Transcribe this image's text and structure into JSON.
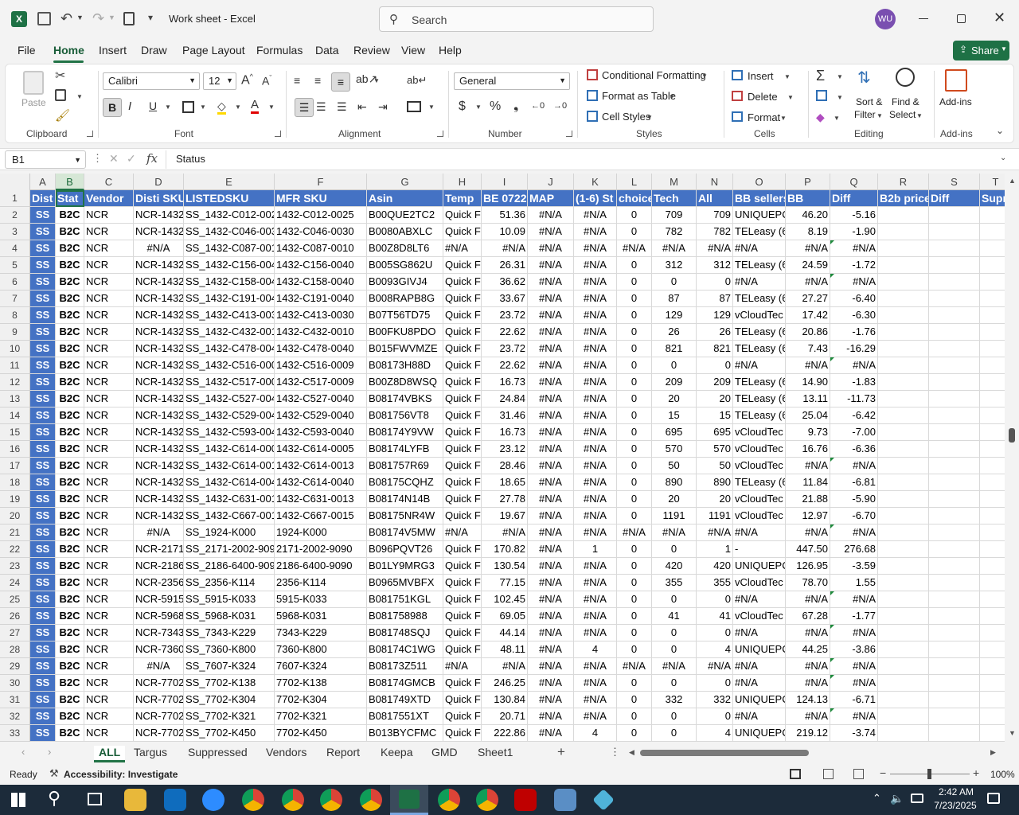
{
  "title": {
    "quick_access_dropdown": "▾",
    "doc": "Work sheet  -  Excel",
    "search_placeholder": "Search",
    "avatar": "WU"
  },
  "menu": [
    "File",
    "Home",
    "Insert",
    "Draw",
    "Page Layout",
    "Formulas",
    "Data",
    "Review",
    "View",
    "Help"
  ],
  "share_label": "Share",
  "ribbon": {
    "paste": "Paste",
    "font_name": "Calibri",
    "font_size": "12",
    "number_format": "General",
    "cond_format": "Conditional Formatting",
    "format_table": "Format as Table",
    "cell_styles": "Cell Styles",
    "insert": "Insert",
    "delete": "Delete",
    "format": "Format",
    "sort_filter_1": "Sort &",
    "sort_filter_2": "Filter",
    "find_select_1": "Find &",
    "find_select_2": "Select",
    "addins": "Add-ins",
    "groups": {
      "clipboard": "Clipboard",
      "font": "Font",
      "alignment": "Alignment",
      "number": "Number",
      "styles": "Styles",
      "cells": "Cells",
      "editing": "Editing",
      "addins": "Add-ins"
    }
  },
  "formula": {
    "name_box": "B1",
    "fx": "fx",
    "content": "Status"
  },
  "columns": [
    "A",
    "B",
    "C",
    "D",
    "E",
    "F",
    "G",
    "H",
    "I",
    "J",
    "K",
    "L",
    "M",
    "N",
    "O",
    "P",
    "Q",
    "R",
    "S",
    "T"
  ],
  "header_row": [
    "Dist",
    "Stat",
    "Vendor",
    "Disti SKU",
    "LISTEDSKU",
    "MFR SKU",
    "Asin",
    "Temp",
    "BE 0722",
    "MAP",
    "(1-6) St",
    "choice",
    "Tech",
    "All",
    "BB sellers",
    "BB",
    "Diff",
    "B2b price",
    "Diff",
    "Supre"
  ],
  "rows": [
    [
      "SS",
      "B2C",
      "NCR",
      "NCR-1432",
      "SS_1432-C012-0025",
      "1432-C012-0025",
      "B00QUE2TC2",
      "Quick F",
      "51.36",
      "#N/A",
      "#N/A",
      "0",
      "709",
      "709",
      "UNIQUEPC",
      "46.20",
      "-5.16"
    ],
    [
      "SS",
      "B2C",
      "NCR",
      "NCR-1432",
      "SS_1432-C046-0030",
      "1432-C046-0030",
      "B0080ABXLC",
      "Quick F",
      "10.09",
      "#N/A",
      "#N/A",
      "0",
      "782",
      "782",
      "TELeasy (6",
      "8.19",
      "-1.90"
    ],
    [
      "SS",
      "B2C",
      "NCR",
      "#N/A",
      "SS_1432-C087-0010",
      "1432-C087-0010",
      "B00Z8D8LT6",
      "#N/A",
      "#N/A",
      "#N/A",
      "#N/A",
      "#N/A",
      "#N/A",
      "#N/A",
      "#N/A",
      "#N/A",
      "#N/A"
    ],
    [
      "SS",
      "B2C",
      "NCR",
      "NCR-1432",
      "SS_1432-C156-0040",
      "1432-C156-0040",
      "B005SG862U",
      "Quick F",
      "26.31",
      "#N/A",
      "#N/A",
      "0",
      "312",
      "312",
      "TELeasy (6",
      "24.59",
      "-1.72"
    ],
    [
      "SS",
      "B2C",
      "NCR",
      "NCR-1432",
      "SS_1432-C158-0040",
      "1432-C158-0040",
      "B0093GIVJ4",
      "Quick F",
      "36.62",
      "#N/A",
      "#N/A",
      "0",
      "0",
      "0",
      "#N/A",
      "#N/A",
      "#N/A"
    ],
    [
      "SS",
      "B2C",
      "NCR",
      "NCR-1432",
      "SS_1432-C191-0040",
      "1432-C191-0040",
      "B008RAPB8G",
      "Quick F",
      "33.67",
      "#N/A",
      "#N/A",
      "0",
      "87",
      "87",
      "TELeasy (6",
      "27.27",
      "-6.40"
    ],
    [
      "SS",
      "B2C",
      "NCR",
      "NCR-1432",
      "SS_1432-C413-0030",
      "1432-C413-0030",
      "B07T56TD75",
      "Quick F",
      "23.72",
      "#N/A",
      "#N/A",
      "0",
      "129",
      "129",
      "vCloudTec",
      "17.42",
      "-6.30"
    ],
    [
      "SS",
      "B2C",
      "NCR",
      "NCR-1432",
      "SS_1432-C432-0010",
      "1432-C432-0010",
      "B00FKU8PDO",
      "Quick F",
      "22.62",
      "#N/A",
      "#N/A",
      "0",
      "26",
      "26",
      "TELeasy (6",
      "20.86",
      "-1.76"
    ],
    [
      "SS",
      "B2C",
      "NCR",
      "NCR-1432",
      "SS_1432-C478-0040",
      "1432-C478-0040",
      "B015FWVMZE",
      "Quick F",
      "23.72",
      "#N/A",
      "#N/A",
      "0",
      "821",
      "821",
      "TELeasy (6",
      "7.43",
      "-16.29"
    ],
    [
      "SS",
      "B2C",
      "NCR",
      "NCR-1432",
      "SS_1432-C516-0009",
      "1432-C516-0009",
      "B08173H88D",
      "Quick F",
      "22.62",
      "#N/A",
      "#N/A",
      "0",
      "0",
      "0",
      "#N/A",
      "#N/A",
      "#N/A"
    ],
    [
      "SS",
      "B2C",
      "NCR",
      "NCR-1432",
      "SS_1432-C517-0009",
      "1432-C517-0009",
      "B00Z8D8WSQ",
      "Quick F",
      "16.73",
      "#N/A",
      "#N/A",
      "0",
      "209",
      "209",
      "TELeasy (6",
      "14.90",
      "-1.83"
    ],
    [
      "SS",
      "B2C",
      "NCR",
      "NCR-1432",
      "SS_1432-C527-0040",
      "1432-C527-0040",
      "B08174VBKS",
      "Quick F",
      "24.84",
      "#N/A",
      "#N/A",
      "0",
      "20",
      "20",
      "TELeasy (6",
      "13.11",
      "-11.73"
    ],
    [
      "SS",
      "B2C",
      "NCR",
      "NCR-1432",
      "SS_1432-C529-0040",
      "1432-C529-0040",
      "B081756VT8",
      "Quick F",
      "31.46",
      "#N/A",
      "#N/A",
      "0",
      "15",
      "15",
      "TELeasy (6",
      "25.04",
      "-6.42"
    ],
    [
      "SS",
      "B2C",
      "NCR",
      "NCR-1432",
      "SS_1432-C593-0040",
      "1432-C593-0040",
      "B08174Y9VW",
      "Quick F",
      "16.73",
      "#N/A",
      "#N/A",
      "0",
      "695",
      "695",
      "vCloudTec",
      "9.73",
      "-7.00"
    ],
    [
      "SS",
      "B2C",
      "NCR",
      "NCR-1432",
      "SS_1432-C614-0005",
      "1432-C614-0005",
      "B08174LYFB",
      "Quick F",
      "23.12",
      "#N/A",
      "#N/A",
      "0",
      "570",
      "570",
      "vCloudTec",
      "16.76",
      "-6.36"
    ],
    [
      "SS",
      "B2C",
      "NCR",
      "NCR-1432",
      "SS_1432-C614-0013",
      "1432-C614-0013",
      "B081757R69",
      "Quick F",
      "28.46",
      "#N/A",
      "#N/A",
      "0",
      "50",
      "50",
      "vCloudTec",
      "#N/A",
      "#N/A"
    ],
    [
      "SS",
      "B2C",
      "NCR",
      "NCR-1432",
      "SS_1432-C614-0040",
      "1432-C614-0040",
      "B08175CQHZ",
      "Quick F",
      "18.65",
      "#N/A",
      "#N/A",
      "0",
      "890",
      "890",
      "TELeasy (6",
      "11.84",
      "-6.81"
    ],
    [
      "SS",
      "B2C",
      "NCR",
      "NCR-1432",
      "SS_1432-C631-0013",
      "1432-C631-0013",
      "B08174N14B",
      "Quick F",
      "27.78",
      "#N/A",
      "#N/A",
      "0",
      "20",
      "20",
      "vCloudTec",
      "21.88",
      "-5.90"
    ],
    [
      "SS",
      "B2C",
      "NCR",
      "NCR-1432",
      "SS_1432-C667-0015",
      "1432-C667-0015",
      "B08175NR4W",
      "Quick F",
      "19.67",
      "#N/A",
      "#N/A",
      "0",
      "1191",
      "1191",
      "vCloudTec",
      "12.97",
      "-6.70"
    ],
    [
      "SS",
      "B2C",
      "NCR",
      "#N/A",
      "SS_1924-K000",
      "1924-K000",
      "B08174V5MW",
      "#N/A",
      "#N/A",
      "#N/A",
      "#N/A",
      "#N/A",
      "#N/A",
      "#N/A",
      "#N/A",
      "#N/A",
      "#N/A"
    ],
    [
      "SS",
      "B2C",
      "NCR",
      "NCR-2171",
      "SS_2171-2002-9090",
      "2171-2002-9090",
      "B096PQVT26",
      "Quick F",
      "170.82",
      "#N/A",
      "1",
      "0",
      "0",
      "1",
      "-",
      "447.50",
      "276.68"
    ],
    [
      "SS",
      "B2C",
      "NCR",
      "NCR-2186",
      "SS_2186-6400-9090",
      "2186-6400-9090",
      "B01LY9MRG3",
      "Quick F",
      "130.54",
      "#N/A",
      "#N/A",
      "0",
      "420",
      "420",
      "UNIQUEPC",
      "126.95",
      "-3.59"
    ],
    [
      "SS",
      "B2C",
      "NCR",
      "NCR-2356",
      "SS_2356-K114",
      "2356-K114",
      "B0965MVBFX",
      "Quick F",
      "77.15",
      "#N/A",
      "#N/A",
      "0",
      "355",
      "355",
      "vCloudTec",
      "78.70",
      "1.55"
    ],
    [
      "SS",
      "B2C",
      "NCR",
      "NCR-5915",
      "SS_5915-K033",
      "5915-K033",
      "B081751KGL",
      "Quick F",
      "102.45",
      "#N/A",
      "#N/A",
      "0",
      "0",
      "0",
      "#N/A",
      "#N/A",
      "#N/A"
    ],
    [
      "SS",
      "B2C",
      "NCR",
      "NCR-5968",
      "SS_5968-K031",
      "5968-K031",
      "B081758988",
      "Quick F",
      "69.05",
      "#N/A",
      "#N/A",
      "0",
      "41",
      "41",
      "vCloudTec",
      "67.28",
      "-1.77"
    ],
    [
      "SS",
      "B2C",
      "NCR",
      "NCR-7343",
      "SS_7343-K229",
      "7343-K229",
      "B081748SQJ",
      "Quick F",
      "44.14",
      "#N/A",
      "#N/A",
      "0",
      "0",
      "0",
      "#N/A",
      "#N/A",
      "#N/A"
    ],
    [
      "SS",
      "B2C",
      "NCR",
      "NCR-7360",
      "SS_7360-K800",
      "7360-K800",
      "B08174C1WG",
      "Quick F",
      "48.11",
      "#N/A",
      "4",
      "0",
      "0",
      "4",
      "UNIQUEPC",
      "44.25",
      "-3.86"
    ],
    [
      "SS",
      "B2C",
      "NCR",
      "#N/A",
      "SS_7607-K324",
      "7607-K324",
      "B08173Z511",
      "#N/A",
      "#N/A",
      "#N/A",
      "#N/A",
      "#N/A",
      "#N/A",
      "#N/A",
      "#N/A",
      "#N/A",
      "#N/A"
    ],
    [
      "SS",
      "B2C",
      "NCR",
      "NCR-7702",
      "SS_7702-K138",
      "7702-K138",
      "B08174GMCB",
      "Quick F",
      "246.25",
      "#N/A",
      "#N/A",
      "0",
      "0",
      "0",
      "#N/A",
      "#N/A",
      "#N/A"
    ],
    [
      "SS",
      "B2C",
      "NCR",
      "NCR-7702",
      "SS_7702-K304",
      "7702-K304",
      "B081749XTD",
      "Quick F",
      "130.84",
      "#N/A",
      "#N/A",
      "0",
      "332",
      "332",
      "UNIQUEPC",
      "124.13",
      "-6.71"
    ],
    [
      "SS",
      "B2C",
      "NCR",
      "NCR-7702",
      "SS_7702-K321",
      "7702-K321",
      "B0817551XT",
      "Quick F",
      "20.71",
      "#N/A",
      "#N/A",
      "0",
      "0",
      "0",
      "#N/A",
      "#N/A",
      "#N/A"
    ],
    [
      "SS",
      "B2C",
      "NCR",
      "NCR-7702",
      "SS_7702-K450",
      "7702-K450",
      "B013BYCFMC",
      "Quick F",
      "222.86",
      "#N/A",
      "4",
      "0",
      "0",
      "4",
      "UNIQUEPC",
      "219.12",
      "-3.74"
    ]
  ],
  "sheets": [
    "ALL",
    "Targus",
    "Suppressed",
    "Vendors",
    "Report",
    "Keepa",
    "GMD",
    "Sheet1"
  ],
  "status": {
    "ready": "Ready",
    "accessibility": "Accessibility: Investigate",
    "zoom": "100%"
  },
  "clock": {
    "time": "2:42 AM",
    "date": "7/23/2025"
  }
}
